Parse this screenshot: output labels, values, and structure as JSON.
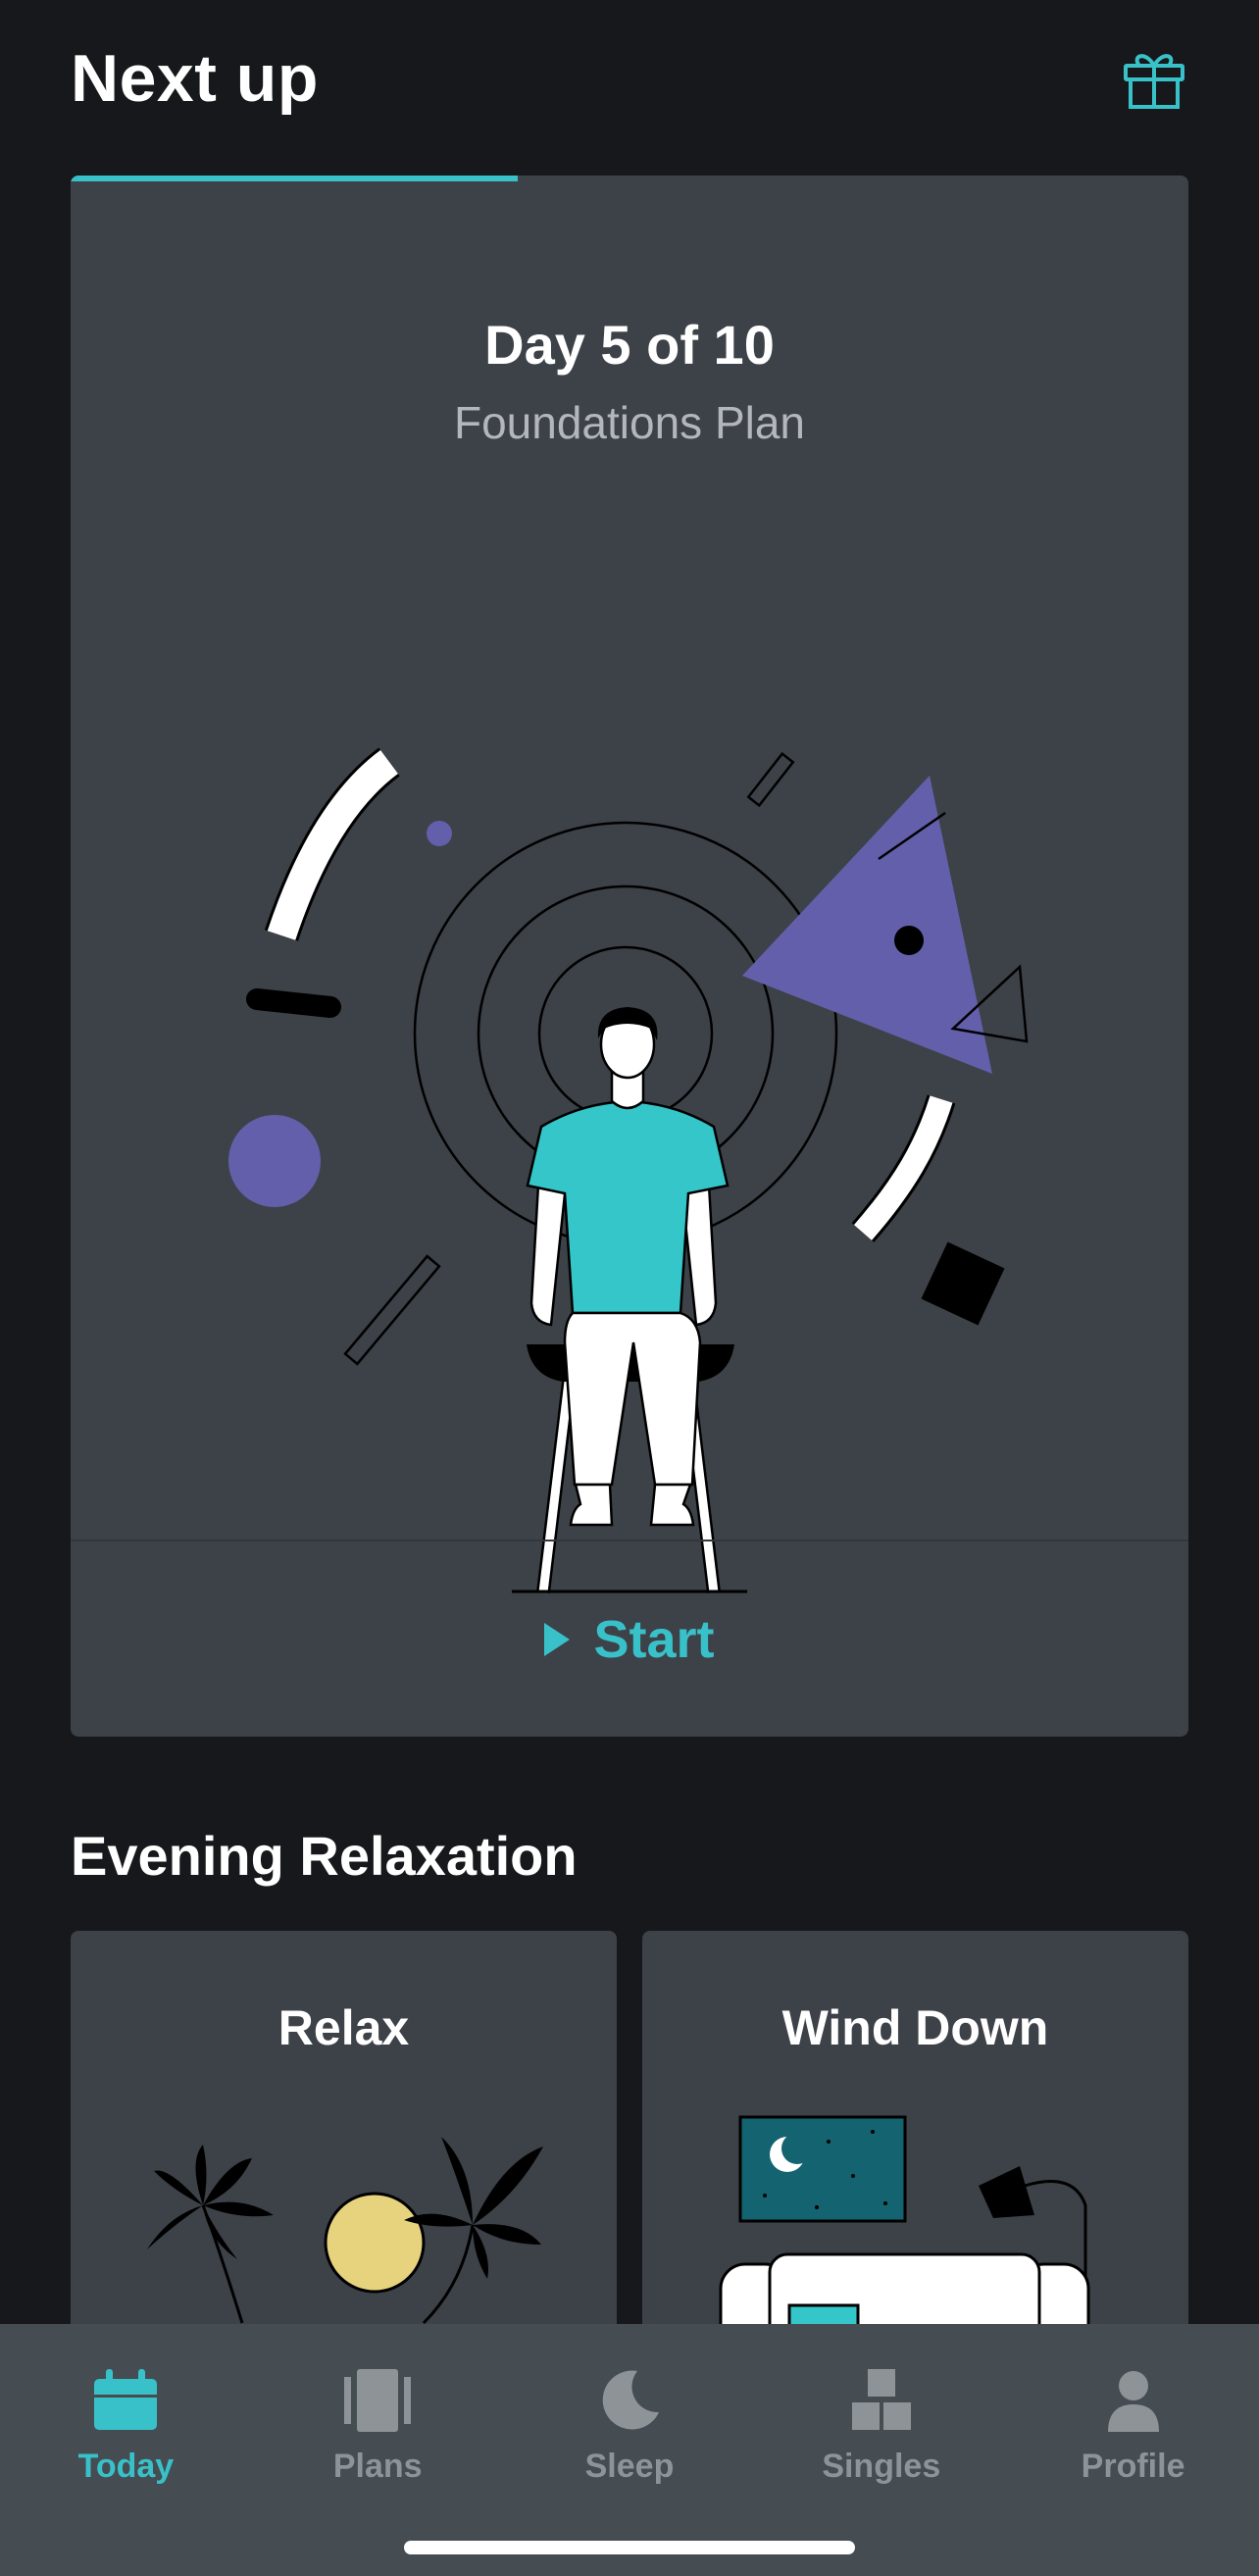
{
  "header": {
    "title": "Next up",
    "gift_icon": "gift-icon"
  },
  "plan": {
    "day_text": "Day 5 of 10",
    "plan_name": "Foundations Plan",
    "progress": 0.4,
    "start_label": "Start",
    "illustration": "meditating-person-illustration"
  },
  "section": {
    "title": "Evening Relaxation"
  },
  "cards": [
    {
      "title": "Relax",
      "illustration": "palm-trees-sun-illustration"
    },
    {
      "title": "Wind Down",
      "illustration": "living-room-night-illustration"
    }
  ],
  "tabs": [
    {
      "label": "Today",
      "icon": "calendar-icon",
      "active": true
    },
    {
      "label": "Plans",
      "icon": "plans-icon",
      "active": false
    },
    {
      "label": "Sleep",
      "icon": "moon-icon",
      "active": false
    },
    {
      "label": "Singles",
      "icon": "blocks-icon",
      "active": false
    },
    {
      "label": "Profile",
      "icon": "person-icon",
      "active": false
    }
  ],
  "colors": {
    "accent": "#39c1c9",
    "card": "#3d4248",
    "background": "#17181b",
    "purple": "#635fab",
    "tabbar": "#454d52"
  }
}
